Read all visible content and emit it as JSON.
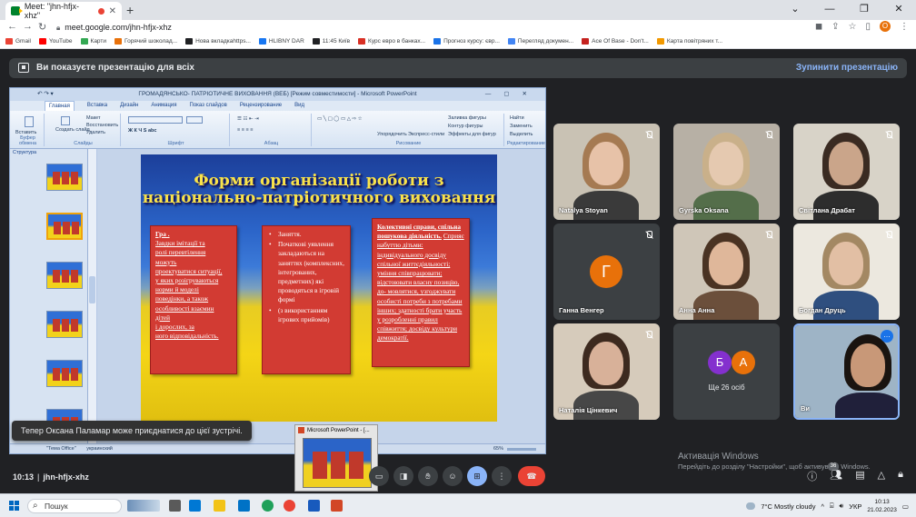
{
  "browser": {
    "tab_title": "Meet: \"jhn-hfjx-xhz\"",
    "url": "meet.google.com/jhn-hfjx-xhz",
    "profile_initial": "О",
    "bookmarks": [
      {
        "label": "Gmail",
        "color": "#ea4335"
      },
      {
        "label": "YouTube",
        "color": "#ff0000"
      },
      {
        "label": "Карти",
        "color": "#34a853"
      },
      {
        "label": "Горячий шоколад...",
        "color": "#e8710a"
      },
      {
        "label": "Нова вкладкаhttps...",
        "color": "#202124"
      },
      {
        "label": "HLIBNY DAR",
        "color": "#1877f2"
      },
      {
        "label": "11:45 Київ",
        "color": "#202124"
      },
      {
        "label": "Курс евро в банках...",
        "color": "#d93025"
      },
      {
        "label": "Прогноз курсу: євр...",
        "color": "#1a73e8"
      },
      {
        "label": "Перегляд докумен...",
        "color": "#4285f4"
      },
      {
        "label": "Ace Of Base - Don't...",
        "color": "#c5221f"
      },
      {
        "label": "Карта повітряних т...",
        "color": "#f29900"
      }
    ]
  },
  "meet": {
    "present_text": "Ви показуєте презентацію для всіх",
    "stop_label": "Зупинити презентацію",
    "toast": "Тепер Оксана Паламар може приєднатися до цієї зустрічі.",
    "time": "10:13",
    "meeting_code": "jhn-hfjx-xhz",
    "people_count": "36",
    "participants": [
      {
        "name": "Natalya Stoyan"
      },
      {
        "name": "Gyrska Oksana"
      },
      {
        "name": "Світлана Драбат"
      },
      {
        "name": "Ганна Венгер",
        "initial": "Г",
        "color": "#e8710a"
      },
      {
        "name": "Анна Анна"
      },
      {
        "name": "Богдан Друць"
      },
      {
        "name": "Наталія Цінкевич"
      },
      {
        "name": "Ще 26 осіб",
        "initials": [
          "Б",
          "А"
        ],
        "colors": [
          "#8430ce",
          "#e8710a"
        ]
      },
      {
        "name": "Ви"
      }
    ]
  },
  "ppt": {
    "title": "ГРОМАДЯНСЬКО- ПАТРІОТИЧНЕ ВИХОВАННЯ (ВЕБ) [Режим совместимости] - Microsoft PowerPoint",
    "menu": [
      "Главная",
      "Вставка",
      "Дизайн",
      "Анимация",
      "Показ слайдов",
      "Рецензирование",
      "Вид"
    ],
    "ribbon_groups": [
      "Буфер обмена",
      "Слайды",
      "Шрифт",
      "Абзац",
      "Рисование",
      "Редактирование"
    ],
    "ribbon_items": {
      "paste": "Вставить",
      "create": "Создать слайд",
      "layout": "Макет",
      "restore": "Восстановить",
      "delete": "Удалить",
      "arrange": "Упорядочить",
      "styles": "Экспресс-стили",
      "fill": "Заливка фигуры",
      "outline": "Контур фигуры",
      "effects": "Эффекты для фигур",
      "find": "Найти",
      "replace": "Заменить",
      "select": "Выделить"
    },
    "panel_label": "Структура",
    "status_theme": "\"Тема Office\"",
    "status_lang": "украинский",
    "zoom": "65%",
    "slide": {
      "title_line1": "Форми організації роботи з",
      "title_line2": "національно-патріотичного виховання",
      "box1_heading": "Гра .",
      "box1_lines": [
        "Завдки імітації та",
        "ролі перевтілення",
        "можуть",
        "проектуватися ситуації,",
        "у яких розігруваються",
        "норми й моделі",
        "поведінки, а також",
        "особливості взаємин",
        "дітей",
        "і дорослих, за",
        "ного відповідальність."
      ],
      "box2_items": [
        "Заняття.",
        "Початкові уявлення закладаються на заняттях (комплексних, інтегрованих, предметних) які проводяться в ігровій формі",
        "(з використанням ігрових прийомів)"
      ],
      "box3_heading": "Колективні справи, спільна пошукова діяльність.",
      "box3_text": "Сприяє набуттю дітьми: індивідуального досвіду спільної життєдіяльності; уміння співпрацювати; відстоювати власну позицію, до- мовлятися, узгоджувати особисті потреби з потребами інших; здатності брати участь у розробленні правил співжиття; досвіду культури демократії."
    }
  },
  "taskbar": {
    "search": "Пошук",
    "thumb_title": "Microsoft PowerPoint - [...",
    "weather": "7°C  Mostly cloudy",
    "lang": "УКР",
    "clock_time": "10:13",
    "clock_date": "21.02.2023",
    "activate_title": "Активація Windows",
    "activate_sub": "Перейдіть до розділу \"Настройки\", щоб активувати Windows."
  }
}
